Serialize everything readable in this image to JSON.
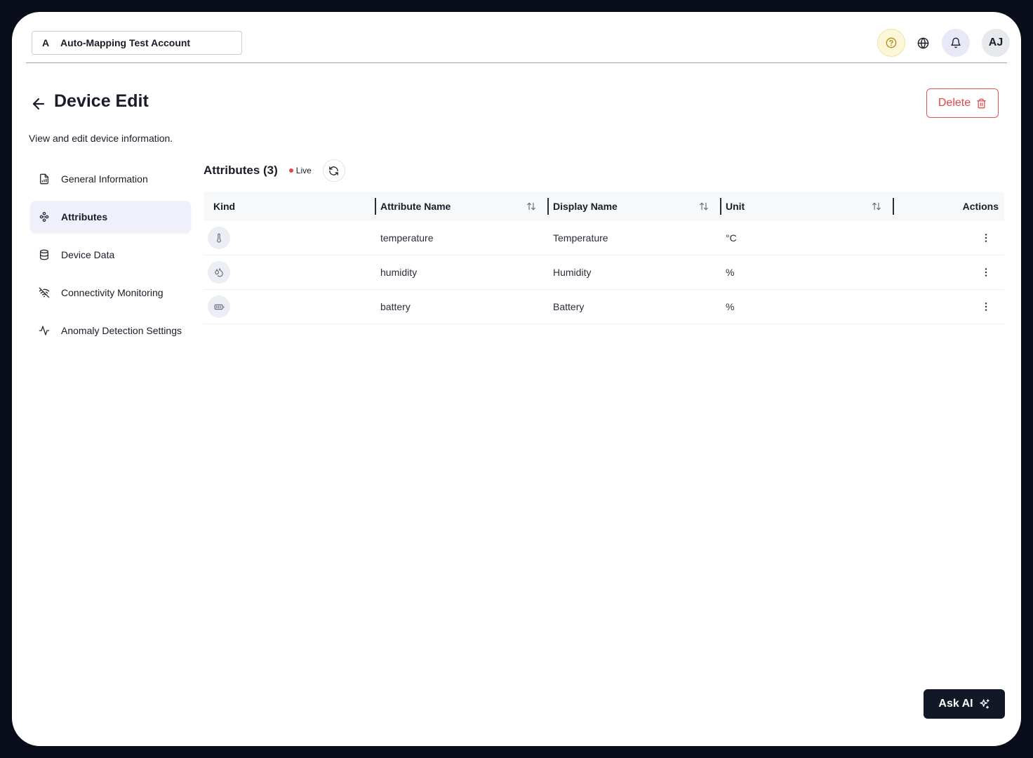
{
  "topbar": {
    "account_initial": "A",
    "account_name": "Auto-Mapping Test Account",
    "avatar_initials": "AJ",
    "icons": [
      "help-icon",
      "globe-icon",
      "bell-icon"
    ]
  },
  "header": {
    "title": "Device Edit",
    "subtitle": "View and edit device information.",
    "delete_label": "Delete"
  },
  "sidenav": {
    "items": [
      {
        "label": "General Information",
        "icon": "file-chart-icon",
        "active": false
      },
      {
        "label": "Attributes",
        "icon": "attributes-icon",
        "active": true
      },
      {
        "label": "Device Data",
        "icon": "database-icon",
        "active": false
      },
      {
        "label": "Connectivity Monitoring",
        "icon": "wifi-off-icon",
        "active": false
      },
      {
        "label": "Anomaly Detection Settings",
        "icon": "activity-icon",
        "active": false
      }
    ]
  },
  "attributes": {
    "title": "Attributes (3)",
    "live_label": "Live",
    "columns": {
      "kind": "Kind",
      "attribute_name": "Attribute Name",
      "display_name": "Display Name",
      "unit": "Unit",
      "actions": "Actions"
    },
    "rows": [
      {
        "kind_icon": "thermometer-icon",
        "attribute_name": "temperature",
        "display_name": "Temperature",
        "unit": "°C"
      },
      {
        "kind_icon": "droplets-icon",
        "attribute_name": "humidity",
        "display_name": "Humidity",
        "unit": "%"
      },
      {
        "kind_icon": "battery-icon",
        "attribute_name": "battery",
        "display_name": "Battery",
        "unit": "%"
      }
    ]
  },
  "ask_ai_label": "Ask AI",
  "colors": {
    "danger": "#e04646",
    "live_dot": "#e34848",
    "nav_active_bg": "#f0f0fa",
    "ask_ai_bg": "#121826"
  }
}
